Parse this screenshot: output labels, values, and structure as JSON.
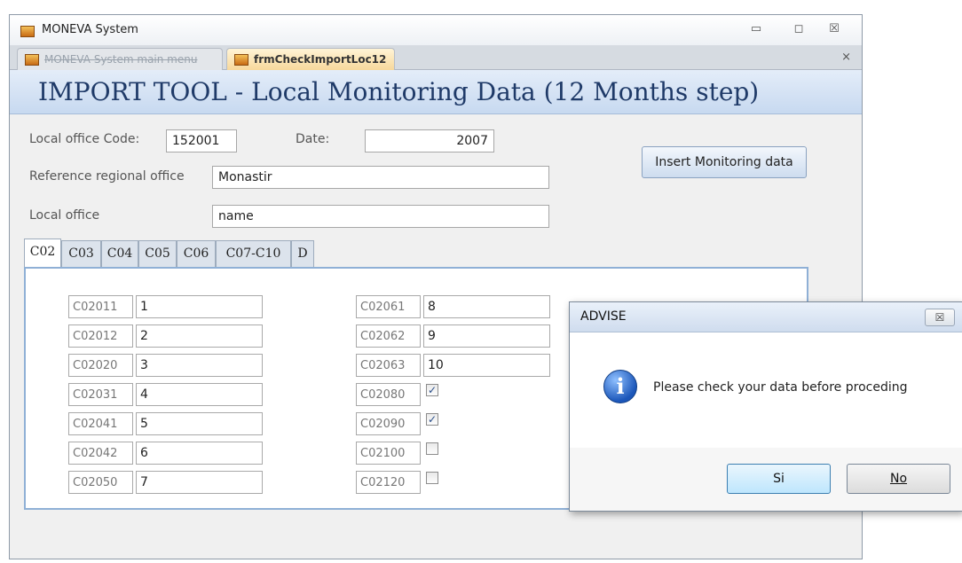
{
  "window": {
    "title": "MONEVA System",
    "controls": {
      "minimize": "▭",
      "restore": "◻",
      "close": "☒"
    },
    "tabs": [
      {
        "label": "MONEVA System main menu",
        "active": false
      },
      {
        "label": "frmCheckImportLoc12",
        "active": true
      }
    ],
    "tab_close": "×"
  },
  "header": {
    "title": "IMPORT TOOL - Local Monitoring Data (12 Months step)"
  },
  "form": {
    "local_office_code_label": "Local office Code:",
    "local_office_code": "152001",
    "date_label": "Date:",
    "date": "2007",
    "reference_regional_office_label": "Reference regional office",
    "reference_regional_office": "Monastir",
    "local_office_label": "Local office",
    "local_office": "name",
    "insert_button": "Insert Monitoring data"
  },
  "subtabs": [
    "C02",
    "C03",
    "C04",
    "C05",
    "C06",
    "C07-C10",
    "D"
  ],
  "selected_subtab": "C02",
  "grid_left": [
    {
      "code": "C02011",
      "value": "1"
    },
    {
      "code": "C02012",
      "value": "2"
    },
    {
      "code": "C02020",
      "value": "3"
    },
    {
      "code": "C02031",
      "value": "4"
    },
    {
      "code": "C02041",
      "value": "5"
    },
    {
      "code": "C02042",
      "value": "6"
    },
    {
      "code": "C02050",
      "value": "7"
    }
  ],
  "grid_right_text": [
    {
      "code": "C02061",
      "value": "8"
    },
    {
      "code": "C02062",
      "value": "9"
    },
    {
      "code": "C02063",
      "value": "10"
    }
  ],
  "grid_right_check": [
    {
      "code": "C02080",
      "checked": true
    },
    {
      "code": "C02090",
      "checked": true
    },
    {
      "code": "C02100",
      "checked": false
    },
    {
      "code": "C02120",
      "checked": false
    }
  ],
  "dialog": {
    "title": "ADVISE",
    "close": "☒",
    "message": "Please check your data before proceding",
    "yes_label": "Si",
    "no_label": "No",
    "info_glyph": "i"
  },
  "icons": {
    "app": "app-icon",
    "info": "info-icon",
    "check": "✓"
  }
}
